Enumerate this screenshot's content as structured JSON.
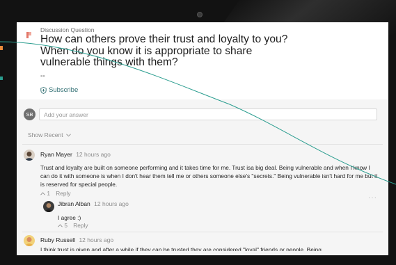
{
  "question": {
    "kicker": "Discussion Question",
    "title": "How can others prove their trust and loyalty to you? When do you know it is appropriate to share vulnerable things with them?",
    "body": "--",
    "subscribe_label": "Subscribe"
  },
  "compose": {
    "avatar_initials": "SB",
    "placeholder": "Add your answer"
  },
  "sort": {
    "label": "Show Recent"
  },
  "comments": [
    {
      "author": "Ryan Mayer",
      "time": "12 hours ago",
      "body": "Trust and loyalty are built on someone performing and it takes time for me. Trust isa big deal. Being vulnerable and when I know I can do it with someone is when I don't hear them tell me or others someone else's \"secrets.\" Being vulnerable isn't hard for me but it is reserved for special people.",
      "votes": "1",
      "reply_label": "Reply"
    },
    {
      "author": "Jibran Alban",
      "time": "12 hours ago",
      "body": "I agree :)",
      "votes": "5",
      "reply_label": "Reply"
    },
    {
      "author": "Ruby Russell",
      "time": "12 hours ago",
      "body": "I think trust is given and after a while if they can be trusted they are considered \"loyal\" friends or people. Being"
    }
  ],
  "icons": {
    "logo": "brand-logo-icon",
    "subscribe": "shield-plus-icon",
    "sort": "chevron-down-icon",
    "upvote": "caret-up-icon",
    "more": "more-horizontal-icon"
  },
  "colors": {
    "accent": "#2e6d71",
    "brand": "#e3786a",
    "line_overlay": "#2a9d8f"
  }
}
